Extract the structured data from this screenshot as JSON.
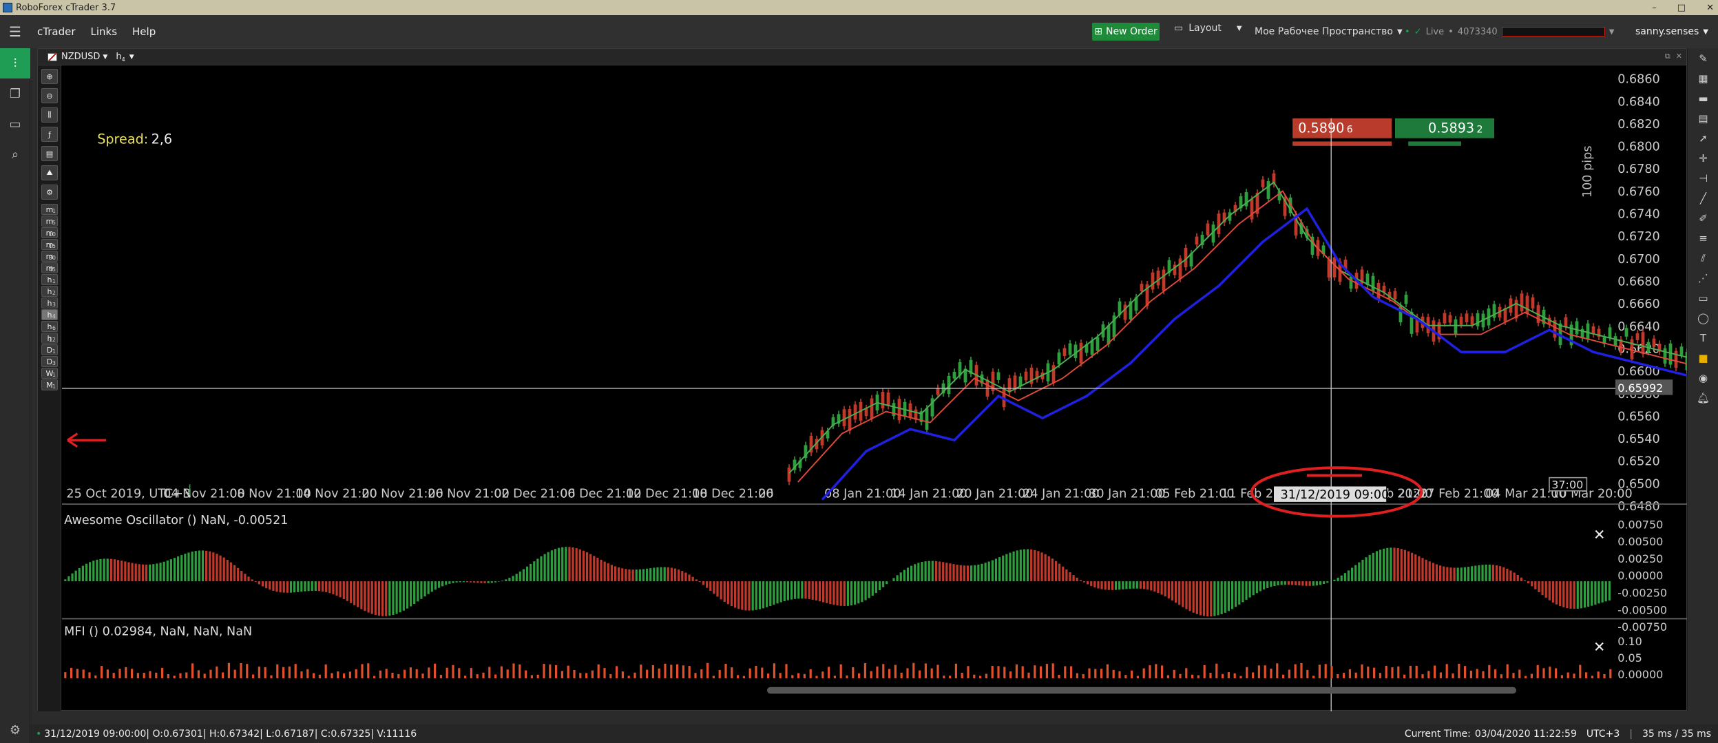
{
  "window": {
    "title": "RoboForex cTrader 3.7",
    "controls": [
      "–",
      "□",
      "✕"
    ]
  },
  "menu": {
    "items": [
      "cTrader",
      "Links",
      "Help"
    ],
    "new_order": "New Order",
    "layout": "Layout",
    "workspace": "Мое Рабочее Пространство",
    "account_mode": "Live",
    "account_number": "4073340",
    "username": "sanny.senses"
  },
  "chart": {
    "symbol": "NZDUSD",
    "timeframe": "h",
    "timeframe_sub": "4",
    "spread_label": "Spread:",
    "spread_value": "2,6",
    "sell_price": "0.5890",
    "sell_price_small": "6",
    "buy_price": "0.5893",
    "buy_price_small": "2",
    "pips_label": "100 pips",
    "crosshair_price": "0.65992",
    "crosshair_time": "31/12/2019 09:00",
    "year_fragment": "2020",
    "countdown": "37:00",
    "price_axis": [
      "0.6860",
      "0.6840",
      "0.6820",
      "0.6800",
      "0.6780",
      "0.6760",
      "0.6740",
      "0.6720",
      "0.6700",
      "0.6680",
      "0.6660",
      "0.6640",
      "0.6620",
      "0.6600",
      "0.6580",
      "0.6560",
      "0.6540",
      "0.6520",
      "0.6500",
      "0.6480"
    ],
    "time_axis": [
      "25 Oct 2019, UTC+3",
      "04 Nov 21:00",
      "08 Nov 21:00",
      "14 Nov 21:00",
      "20 Nov 21:00",
      "26 Nov 21:00",
      "02 Dec 21:00",
      "06 Dec 21:00",
      "12 Dec 21:00",
      "18 Dec 21:00",
      "26",
      "08 Jan 21:00",
      "14 Jan 21:00",
      "20 Jan 21:00",
      "24 Jan 21:00",
      "30 Jan 21:00",
      "05 Feb 21:00",
      "11 Feb 21:00",
      "17 Feb 21:00",
      "21 Feb 21:00",
      "27 Feb 21:00",
      "04 Mar 21:00",
      "10 Mar 20:00"
    ],
    "ao_label": "Awesome Oscillator () NaN, -0.00521",
    "ao_axis": [
      "0.00750",
      "0.00500",
      "0.00250",
      "0.00000",
      "-0.00250",
      "-0.00500",
      "-0.00750"
    ],
    "mfi_label": "MFI () 0.02984, NaN, NaN, NaN",
    "mfi_axis": [
      "0.10",
      "0.05",
      "0.00000"
    ]
  },
  "timeframes": [
    {
      "label": "m",
      "sub": "1"
    },
    {
      "label": "m",
      "sub": "5"
    },
    {
      "label": "m",
      "sub": "10"
    },
    {
      "label": "m",
      "sub": "15"
    },
    {
      "label": "m",
      "sub": "30"
    },
    {
      "label": "m",
      "sub": "45"
    },
    {
      "label": "h",
      "sub": "1"
    },
    {
      "label": "h",
      "sub": "2"
    },
    {
      "label": "h",
      "sub": "3"
    },
    {
      "label": "h",
      "sub": "4"
    },
    {
      "label": "h",
      "sub": "6"
    },
    {
      "label": "h",
      "sub": "12"
    },
    {
      "label": "D",
      "sub": "1"
    },
    {
      "label": "D",
      "sub": "3"
    },
    {
      "label": "W",
      "sub": "1"
    },
    {
      "label": "M",
      "sub": "1"
    }
  ],
  "status": {
    "bar_info": "31/12/2019 09:00:00| O:0.67301| H:0.67342| L:0.67187| C:0.67325| V:11116",
    "current_time_label": "Current Time:",
    "current_time": "03/04/2020 11:22:59",
    "timezone": "UTC+3",
    "latency": "35 ms / 35 ms"
  },
  "colors": {
    "bull": "#2e9e3e",
    "bear": "#c0392b",
    "ma_fast": "#4caf50",
    "ma_mid": "#e04a3a",
    "ma_slow": "#2020e0",
    "accent": "#1f9d55"
  }
}
